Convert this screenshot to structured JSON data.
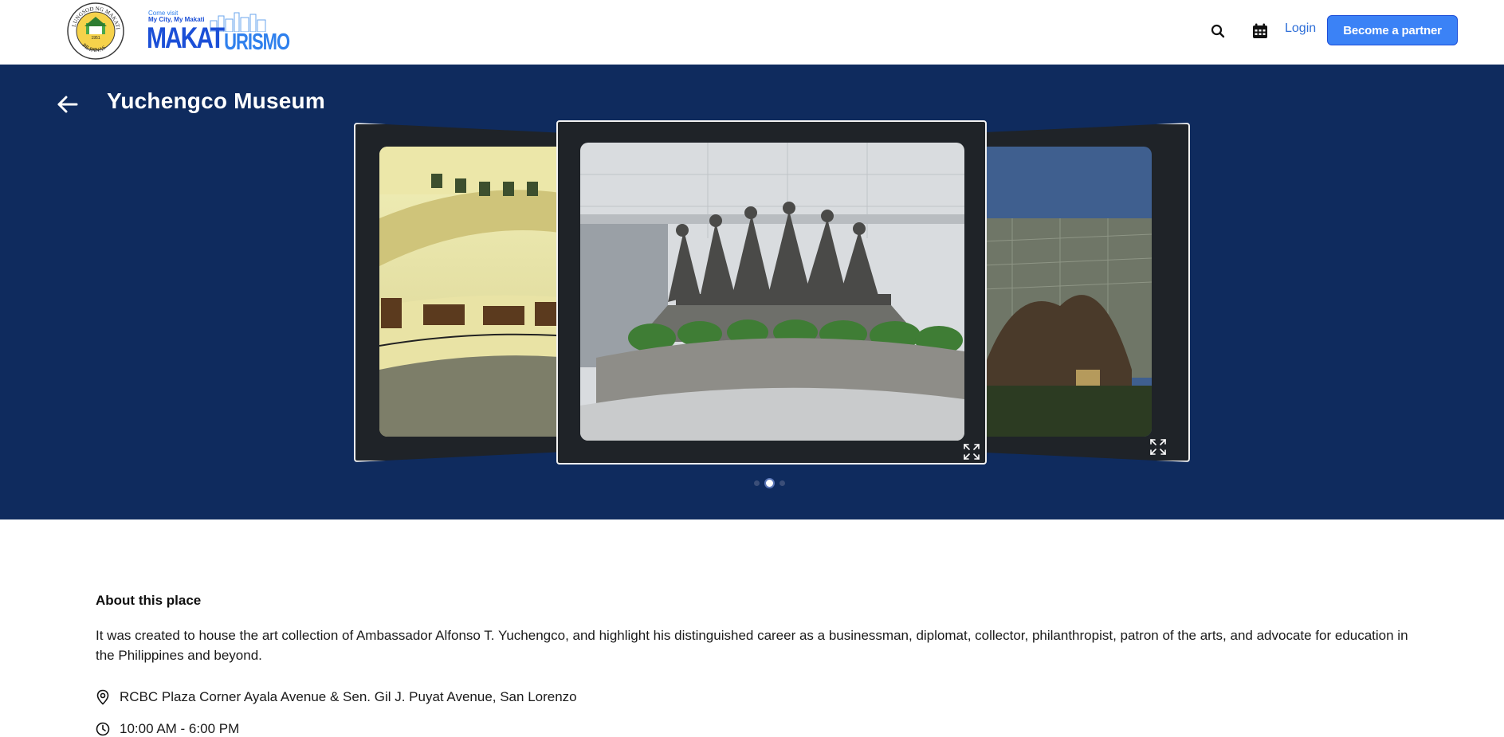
{
  "header": {
    "seal_text_top": "LUNGSOD NG MAKATI",
    "seal_text_bottom": "PILIPINAS",
    "seal_year": "1951",
    "brand_line1": "Come visit",
    "brand_line2": "My City, My Makati",
    "brand_word1": "MAKAT",
    "brand_word2": "URISMO",
    "login_label": "Login",
    "partner_label": "Become a partner",
    "search_icon": "search-icon",
    "calendar_icon": "calendar-icon"
  },
  "hero": {
    "title": "Yuchengco Museum",
    "back_icon": "arrow-left-icon",
    "slides_count": 3,
    "active_slide": 1,
    "expand_icon": "expand-icon",
    "background_color": "#0f2b5e"
  },
  "content": {
    "about_heading": "About this place",
    "about_text": "It was created to house the art collection of Ambassador Alfonso T. Yuchengco, and highlight his distinguished career as a businessman, diplomat, collector, philanthropist, patron of the arts, and advocate for education in the Philippines and beyond.",
    "address": "RCBC Plaza Corner Ayala Avenue & Sen. Gil J. Puyat Avenue, San Lorenzo",
    "hours": "10:00 AM - 6:00 PM",
    "location_icon": "map-pin-icon",
    "clock_icon": "clock-icon"
  }
}
